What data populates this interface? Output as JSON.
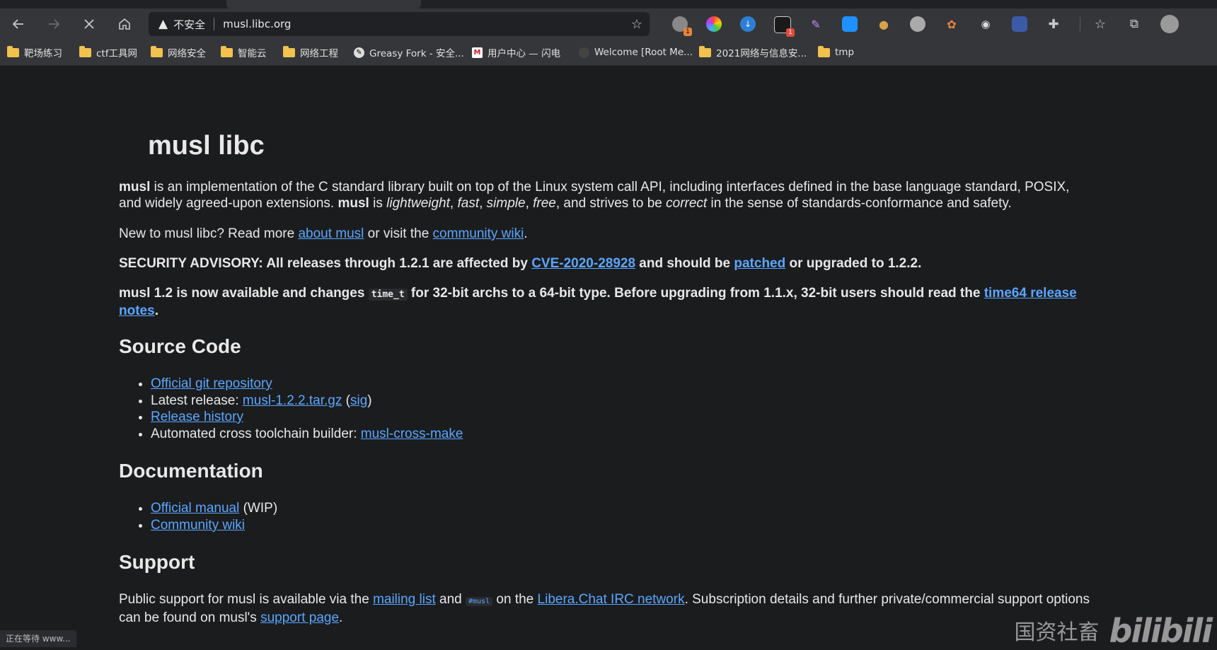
{
  "browser": {
    "address_bar": {
      "security_label": "不安全",
      "url": "musl.libc.org"
    },
    "extensions": [
      "ext-1",
      "ext-2",
      "ext-3",
      "ext-4",
      "ext-5",
      "ext-6",
      "ext-7",
      "ext-8",
      "ext-9",
      "ext-10",
      "ext-11"
    ],
    "extension_badges": {
      "first": "1",
      "fourth": "1"
    },
    "bookmarks": [
      {
        "label": "靶场练习",
        "type": "folder"
      },
      {
        "label": "ctf工具网",
        "type": "folder"
      },
      {
        "label": "网络安全",
        "type": "folder"
      },
      {
        "label": "智能云",
        "type": "folder"
      },
      {
        "label": "网络工程",
        "type": "folder"
      },
      {
        "label": "Greasy Fork - 安全...",
        "type": "site"
      },
      {
        "label": "用户中心 — 闪电",
        "type": "site"
      },
      {
        "label": "Welcome [Root Me...",
        "type": "site"
      },
      {
        "label": "2021网络与信息安...",
        "type": "folder"
      },
      {
        "label": "tmp",
        "type": "folder"
      }
    ],
    "status_text": "正在等待 www..."
  },
  "page": {
    "title": "musl libc",
    "intro": {
      "musl1": "musl",
      "text1": " is an implementation of the C standard library built on top of the Linux system call API, including interfaces defined in the base language standard, POSIX, and widely agreed-upon extensions. ",
      "musl2": "musl",
      "text2": " is ",
      "lightweight": "lightweight",
      "comma1": ", ",
      "fast": "fast",
      "comma2": ", ",
      "simple": "simple",
      "comma3": ", ",
      "free": "free",
      "text3": ", and strives to be ",
      "correct": "correct",
      "text4": " in the sense of standards-conformance and safety."
    },
    "new_to": {
      "text1": "New to musl libc? Read more ",
      "link1": "about musl",
      "text2": " or visit the ",
      "link2": "community wiki",
      "text3": "."
    },
    "advisory": {
      "text1": "SECURITY ADVISORY: All releases through 1.2.1 are affected by ",
      "cve_link": "CVE-2020-28928",
      "text2": " and should be ",
      "patched_link": "patched",
      "text3": " or upgraded to 1.2.2."
    },
    "release_note": {
      "text1": "musl 1.2 is now available and changes ",
      "code": "time_t",
      "text2": " for 32-bit archs to a 64-bit type. Before upgrading from 1.1.x, 32-bit users should read the ",
      "link": "time64 release notes",
      "text3": "."
    },
    "source_code": {
      "heading": "Source Code",
      "git_link": "Official git repository",
      "latest_prefix": "Latest release: ",
      "tarball_link": "musl-1.2.2.tar.gz",
      "paren_open": " (",
      "sig_link": "sig",
      "paren_close": ")",
      "history_link": "Release history",
      "cross_prefix": "Automated cross toolchain builder: ",
      "cross_link": "musl-cross-make"
    },
    "documentation": {
      "heading": "Documentation",
      "manual_link": "Official manual",
      "manual_suffix": " (WIP)",
      "wiki_link": "Community wiki"
    },
    "support": {
      "heading": "Support",
      "text1": "Public support for musl is available via the ",
      "mailing_link": "mailing list",
      "text2": " and ",
      "irc_channel": "#musl",
      "text3": " on the ",
      "irc_link": "Libera.Chat IRC network",
      "text4": ". Subscription details and further private/commercial support options can be found on musl's ",
      "support_link": "support page",
      "text5": "."
    }
  },
  "watermark": {
    "text": "国资社畜",
    "logo": "bilibili"
  }
}
